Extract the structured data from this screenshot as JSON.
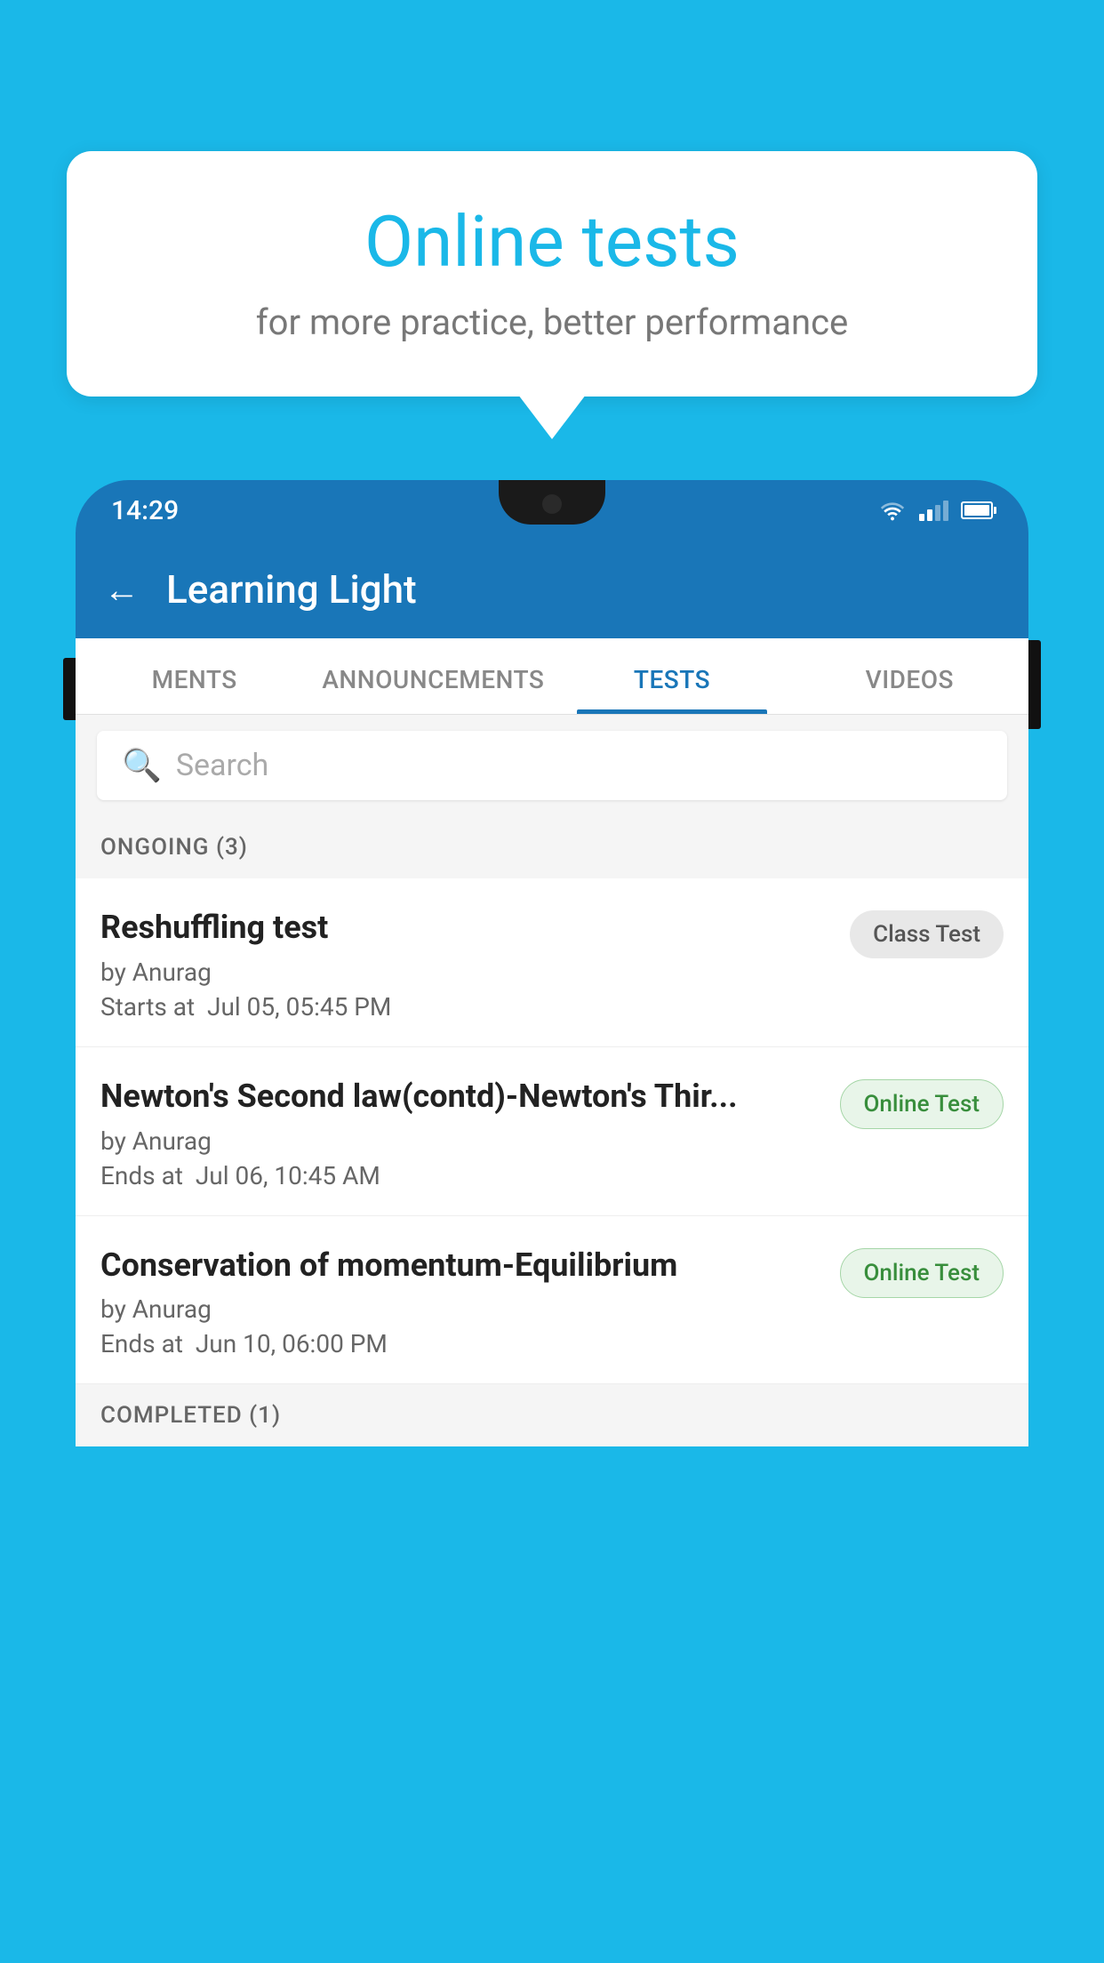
{
  "background_color": "#1ab8e8",
  "bubble": {
    "title": "Online tests",
    "subtitle": "for more practice, better performance"
  },
  "phone": {
    "status_bar": {
      "time": "14:29"
    },
    "toolbar": {
      "title": "Learning Light",
      "back_label": "←"
    },
    "tabs": [
      {
        "id": "ments",
        "label": "MENTS",
        "active": false
      },
      {
        "id": "announcements",
        "label": "ANNOUNCEMENTS",
        "active": false
      },
      {
        "id": "tests",
        "label": "TESTS",
        "active": true
      },
      {
        "id": "videos",
        "label": "VIDEOS",
        "active": false
      }
    ],
    "search": {
      "placeholder": "Search"
    },
    "section_ongoing": {
      "label": "ONGOING (3)"
    },
    "tests": [
      {
        "id": "test-1",
        "name": "Reshuffling test",
        "by": "by Anurag",
        "time_label": "Starts at",
        "time": "Jul 05, 05:45 PM",
        "badge": "Class Test",
        "badge_type": "class"
      },
      {
        "id": "test-2",
        "name": "Newton's Second law(contd)-Newton's Thir...",
        "by": "by Anurag",
        "time_label": "Ends at",
        "time": "Jul 06, 10:45 AM",
        "badge": "Online Test",
        "badge_type": "online"
      },
      {
        "id": "test-3",
        "name": "Conservation of momentum-Equilibrium",
        "by": "by Anurag",
        "time_label": "Ends at",
        "time": "Jun 10, 06:00 PM",
        "badge": "Online Test",
        "badge_type": "online"
      }
    ],
    "section_completed": {
      "label": "COMPLETED (1)"
    }
  }
}
